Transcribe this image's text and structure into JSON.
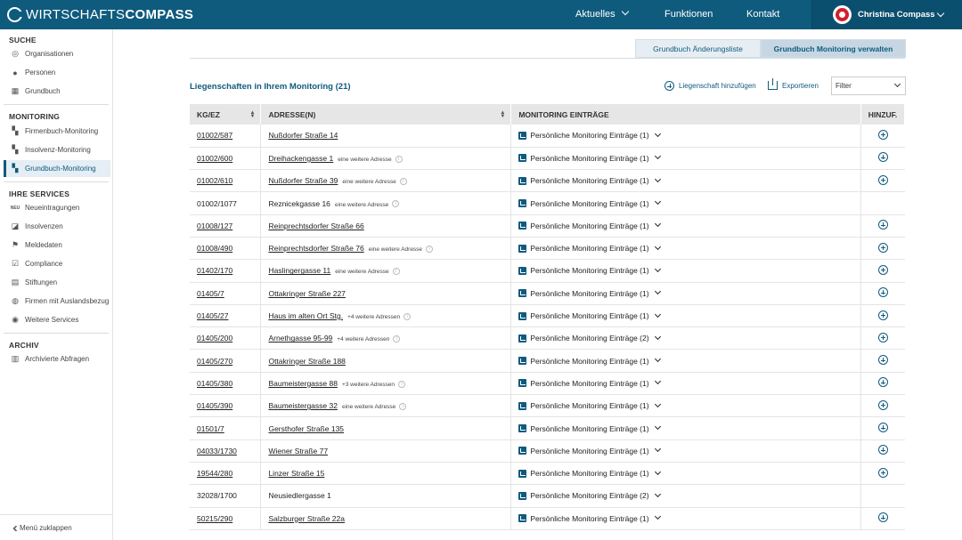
{
  "header": {
    "logo_light": "WIRTSCHAFTS",
    "logo_bold": "COMPASS",
    "nav": [
      "Aktuelles",
      "Funktionen",
      "Kontakt"
    ],
    "user_name": "Christina Compass"
  },
  "sidebar": {
    "sections": [
      {
        "title": "SUCHE",
        "items": [
          "Organisationen",
          "Personen",
          "Grundbuch"
        ]
      },
      {
        "title": "MONITORING",
        "items": [
          "Firmenbuch-Monitoring",
          "Insolvenz-Monitoring",
          "Grundbuch-Monitoring"
        ]
      },
      {
        "title": "IHRE SERVICES",
        "items": [
          "Neueintragungen",
          "Insolvenzen",
          "Meldedaten",
          "Compliance",
          "Stiftungen",
          "Firmen mit Auslandsbezug",
          "Weitere Services"
        ]
      },
      {
        "title": "ARCHIV",
        "items": [
          "Archivierte Abfragen"
        ]
      }
    ],
    "new_badge": "NEU",
    "collapse_label": "Menü zuklappen"
  },
  "tabs": [
    "Grundbuch Änderungsliste",
    "Grundbuch Monitoring verwalten"
  ],
  "list_title": "Liegenschaften in Ihrem Monitoring (21)",
  "actions": {
    "add": "Liegenschaft hinzufügen",
    "export": "Exportieren"
  },
  "filter": {
    "label": "Filter"
  },
  "table": {
    "headers": [
      "KG/EZ",
      "ADRESSE(N)",
      "MONITORING EINTRÄGE",
      "HINZUF."
    ],
    "rows": [
      {
        "kgez": "01002/587",
        "address": "Nußdorfer Straße 14",
        "more": "",
        "monitoring": "Persönliche Monitoring Einträge (1)",
        "linked": true
      },
      {
        "kgez": "01002/600",
        "address": "Dreihackengasse 1",
        "more": "eine weitere Adresse",
        "monitoring": "Persönliche Monitoring Einträge (1)",
        "linked": true
      },
      {
        "kgez": "01002/610",
        "address": "Nußdorfer Straße 39",
        "more": "eine weitere Adresse",
        "monitoring": "Persönliche Monitoring Einträge (1)",
        "linked": true
      },
      {
        "kgez": "01002/1077",
        "address": "Reznicekgasse 16",
        "more": "eine weitere Adresse",
        "monitoring": "Persönliche Monitoring Einträge (1)",
        "linked": false
      },
      {
        "kgez": "01008/127",
        "address": "Reinprechtsdorfer Straße 66",
        "more": "",
        "monitoring": "Persönliche Monitoring Einträge (1)",
        "linked": true
      },
      {
        "kgez": "01008/490",
        "address": "Reinprechtsdorfer Straße 76",
        "more": "eine weitere Adresse",
        "monitoring": "Persönliche Monitoring Einträge (1)",
        "linked": true
      },
      {
        "kgez": "01402/170",
        "address": "Haslingergasse 11",
        "more": "eine weitere Adresse",
        "monitoring": "Persönliche Monitoring Einträge (1)",
        "linked": true
      },
      {
        "kgez": "01405/7",
        "address": "Ottakringer Straße 227",
        "more": "",
        "monitoring": "Persönliche Monitoring Einträge (1)",
        "linked": true
      },
      {
        "kgez": "01405/27",
        "address": "Haus im alten Ort Stg.",
        "more": "+4 weitere Adressen",
        "monitoring": "Persönliche Monitoring Einträge (1)",
        "linked": true
      },
      {
        "kgez": "01405/200",
        "address": "Arnethgasse 95-99",
        "more": "+4 weitere Adressen",
        "monitoring": "Persönliche Monitoring Einträge (2)",
        "linked": true
      },
      {
        "kgez": "01405/270",
        "address": "Ottakringer Straße 188",
        "more": "",
        "monitoring": "Persönliche Monitoring Einträge (1)",
        "linked": true
      },
      {
        "kgez": "01405/380",
        "address": "Baumeistergasse 88",
        "more": "+3 weitere Adressen",
        "monitoring": "Persönliche Monitoring Einträge (1)",
        "linked": true
      },
      {
        "kgez": "01405/390",
        "address": "Baumeistergasse 32",
        "more": "eine weitere Adresse",
        "monitoring": "Persönliche Monitoring Einträge (1)",
        "linked": true
      },
      {
        "kgez": "01501/7",
        "address": "Gersthofer Straße 135",
        "more": "",
        "monitoring": "Persönliche Monitoring Einträge (1)",
        "linked": true
      },
      {
        "kgez": "04033/1730",
        "address": "Wiener Straße 77",
        "more": "",
        "monitoring": "Persönliche Monitoring Einträge (1)",
        "linked": true
      },
      {
        "kgez": "19544/280",
        "address": "Linzer Straße 15",
        "more": "",
        "monitoring": "Persönliche Monitoring Einträge (1)",
        "linked": true
      },
      {
        "kgez": "32028/1700",
        "address": "Neusiedlergasse 1",
        "more": "",
        "monitoring": "Persönliche Monitoring Einträge (2)",
        "linked": false
      },
      {
        "kgez": "50215/290",
        "address": "Salzburger Straße 22a",
        "more": "",
        "monitoring": "Persönliche Monitoring Einträge (1)",
        "linked": true
      }
    ]
  }
}
